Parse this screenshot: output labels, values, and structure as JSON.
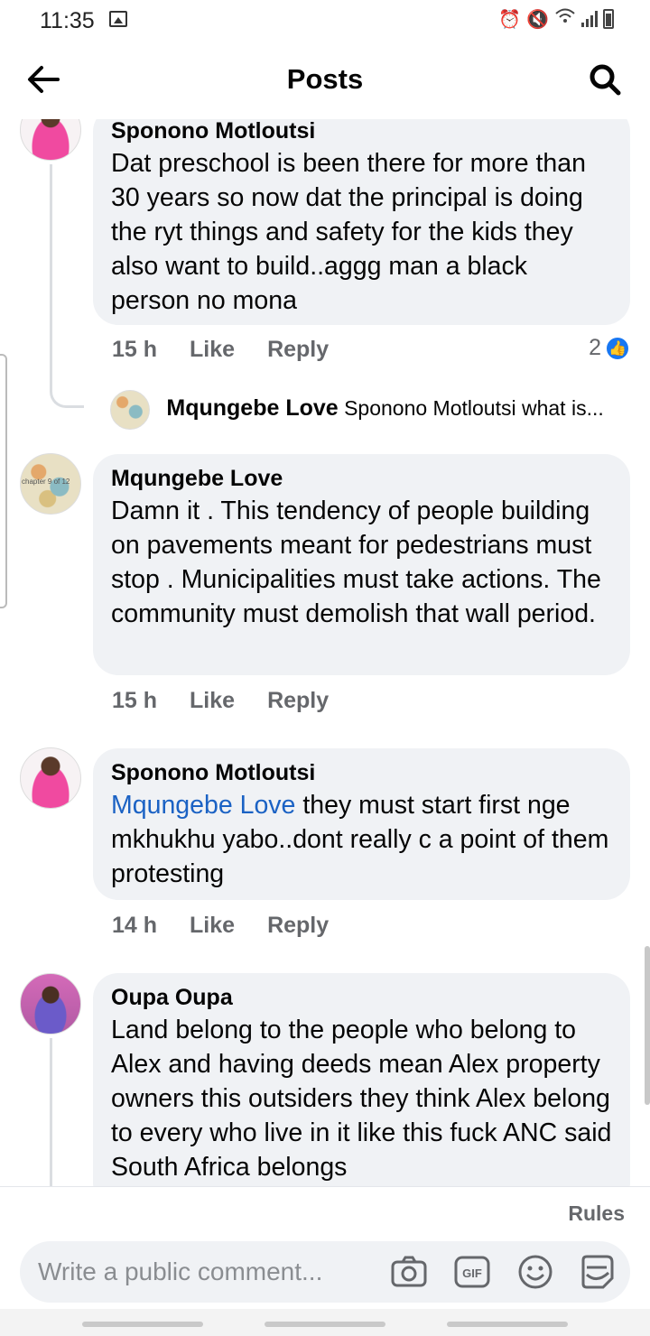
{
  "status_bar": {
    "time": "11:35",
    "icons": [
      "image-icon",
      "alarm-icon",
      "mute-icon",
      "wifi-icon",
      "signal-icon",
      "battery-icon"
    ]
  },
  "app_bar": {
    "title": "Posts",
    "back_icon": "arrow-left-icon",
    "search_icon": "search-icon"
  },
  "comments": [
    {
      "author": "Sponono Motloutsi",
      "text": "Dat preschool is been there for more than 30 years so now dat the principal is doing the ryt things and safety for the kids they also want to build..aggg man a black person no mona",
      "time": "15 h",
      "like_label": "Like",
      "reply_label": "Reply",
      "reaction_count": "2",
      "reaction_icon": "thumbs-up-icon"
    },
    {
      "author": "Mqungebe Love",
      "avatar_text": "chapter 9 of 12",
      "text": "Damn it . This tendency of people building on pavements meant for pedestrians must stop . Municipalities must take actions. The community must demolish that wall period.",
      "time": "15 h",
      "like_label": "Like",
      "reply_label": "Reply"
    },
    {
      "author": "Sponono Motloutsi",
      "mention": "Mqungebe Love",
      "text": " they must start first nge mkhukhu yabo..dont really c a point of them protesting",
      "time": "14 h",
      "like_label": "Like",
      "reply_label": "Reply"
    },
    {
      "author": "Oupa Oupa",
      "text": "Land belong to the people who belong to Alex and having deeds mean Alex property owners this outsiders they think Alex belong to every who live in it like this fuck ANC said South Africa belongs"
    }
  ],
  "reply_summary": {
    "author": "Mqungebe Love",
    "text": "Sponono Motloutsi what is..."
  },
  "composer": {
    "rules_label": "Rules",
    "placeholder": "Write a public comment...",
    "tools": [
      "camera-icon",
      "gif-icon",
      "emoji-icon",
      "sticker-icon"
    ],
    "gif_label": "GIF"
  },
  "colors": {
    "accent": "#1877f2",
    "mention": "#1b62c4",
    "bubble": "#f0f2f5",
    "secondary_text": "#65676b"
  }
}
